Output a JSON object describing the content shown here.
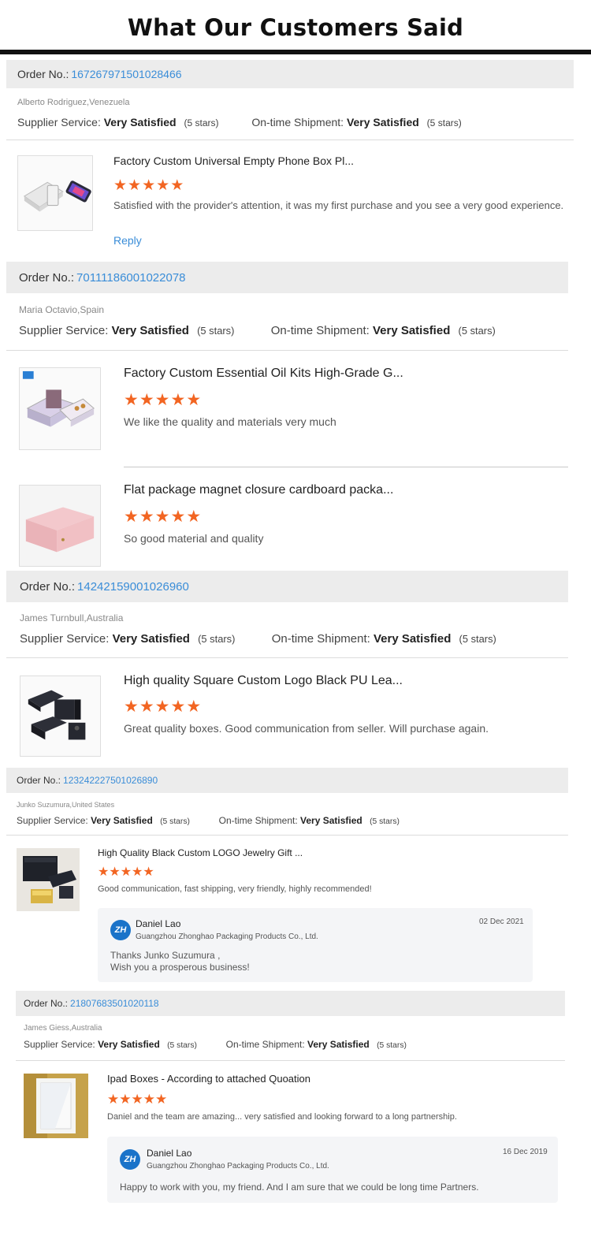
{
  "page": {
    "title": "What Our Customers Said"
  },
  "common": {
    "order_label": "Order No.:",
    "supplier_label": "Supplier Service:",
    "shipment_label": "On-time Shipment:",
    "satisfied": "Very Satisfied",
    "stars_note": "(5 stars)",
    "reply_label": "Reply",
    "star_glyph": "★",
    "star_color": "#f26522",
    "link_color": "#3a8dd8"
  },
  "reviews": [
    {
      "order_no": "167267971501028466",
      "buyer": "Alberto Rodriguez,Venezuela",
      "products": [
        {
          "title": "Factory Custom Universal Empty Phone Box Pl...",
          "rating": 5,
          "text": "Satisfied with the provider's attention, it was my first purchase and you see a very good experience.",
          "thumb_icon": "phone-box-image"
        }
      ]
    },
    {
      "order_no": "70111186001022078",
      "buyer": "Maria Octavio,Spain",
      "products": [
        {
          "title": "Factory Custom Essential Oil Kits High-Grade G...",
          "rating": 5,
          "text": "We like the quality  and materials very much",
          "thumb_icon": "essential-oil-kit-image"
        },
        {
          "title": "Flat package magnet closure cardboard packa...",
          "rating": 5,
          "text": "So good material and quality",
          "thumb_icon": "pink-box-image"
        }
      ]
    },
    {
      "order_no": "14242159001026960",
      "buyer": "James Turnbull,Australia",
      "products": [
        {
          "title": "High quality Square Custom Logo Black PU Lea...",
          "rating": 5,
          "text": "Great quality boxes. Good communication from seller. Will purchase again.",
          "thumb_icon": "black-pu-boxes-image"
        }
      ]
    },
    {
      "order_no": "123242227501026890",
      "buyer": "Junko Suzumura,United States",
      "products": [
        {
          "title": "High Quality Black Custom LOGO Jewelry Gift ...",
          "rating": 5,
          "text": "Good communication, fast shipping, very friendly, highly recommended!",
          "thumb_icon": "jewelry-gift-box-image"
        }
      ],
      "reply": {
        "avatar": "ZH",
        "name": "Daniel Lao",
        "company": "Guangzhou Zhonghao Packaging Products Co., Ltd.",
        "date": "02 Dec 2021",
        "line1": "Thanks Junko Suzumura ,",
        "line2": "Wish you a prosperous business!"
      }
    },
    {
      "order_no": "21807683501020118",
      "buyer": "James Giess,Australia",
      "products": [
        {
          "title": "Ipad Boxes - According to attached Quoation",
          "rating": 5,
          "text": "Daniel and the team are amazing... very satisfied and looking forward to a long partnership.",
          "thumb_icon": "ipad-box-image"
        }
      ],
      "reply": {
        "avatar": "ZH",
        "name": "Daniel Lao",
        "company": "Guangzhou Zhonghao Packaging Products Co., Ltd.",
        "date": "16 Dec 2019",
        "line1": "Happy to work with you, my friend. And I am sure that we could be long time Partners."
      }
    }
  ]
}
